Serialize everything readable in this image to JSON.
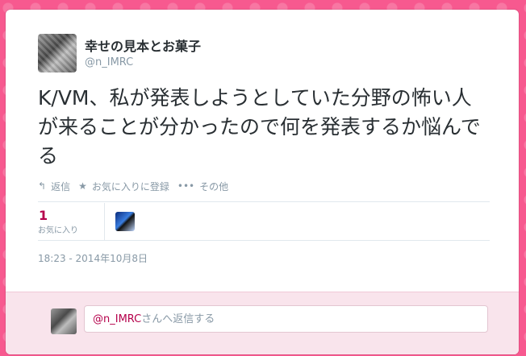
{
  "tweet": {
    "display_name": "幸せの見本とお菓子",
    "handle": "@n_IMRC",
    "text": "K/VM、私が発表しようとしていた分野の怖い人が来ることが分かったので何を発表するか悩んでる",
    "timestamp": "18:23 - 2014年10月8日"
  },
  "actions": {
    "reply_label": "返信",
    "favorite_label": "お気に入りに登録",
    "more_label": "その他",
    "reply_icon": "reply-arrow-icon",
    "favorite_icon": "star-icon",
    "more_icon": "ellipsis-icon"
  },
  "stats": {
    "favorites_count": "1",
    "favorites_label": "お気に入り"
  },
  "reply": {
    "mention": "@n_IMRC",
    "placeholder_suffix": "さんへ返信する"
  },
  "colors": {
    "background": "#f7598f",
    "accent": "#b5004b",
    "muted": "#8899a6"
  }
}
